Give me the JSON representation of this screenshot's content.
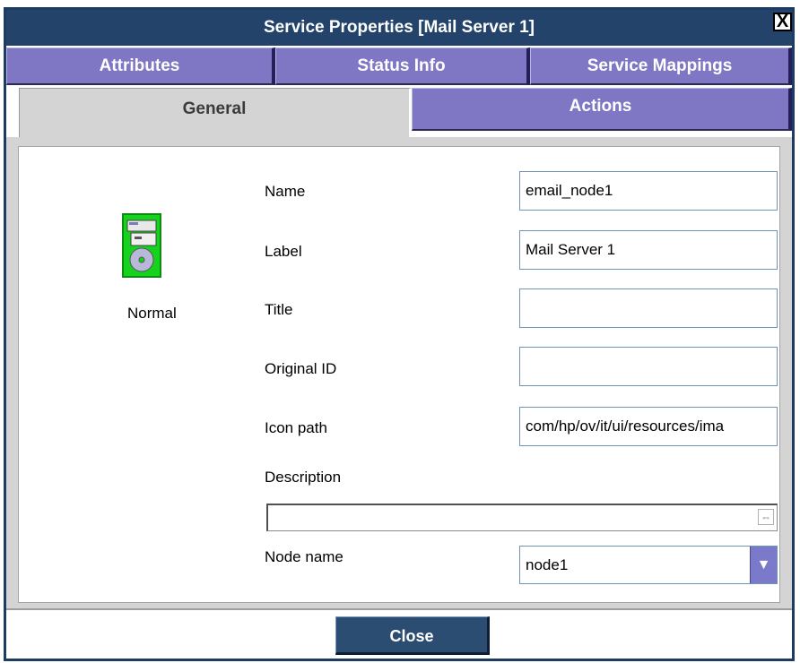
{
  "window": {
    "title": "Service Properties [Mail Server 1]",
    "close_glyph": "X"
  },
  "tabs_row1": [
    {
      "label": "Attributes"
    },
    {
      "label": "Status Info"
    },
    {
      "label": "Service Mappings"
    }
  ],
  "tabs_row2": [
    {
      "label": "General",
      "active": true
    },
    {
      "label": "Actions",
      "active": false
    }
  ],
  "status": {
    "label": "Normal",
    "icon": "server-computer-icon",
    "color": "#17d11f"
  },
  "form": {
    "name": {
      "label": "Name",
      "value": "email_node1"
    },
    "label": {
      "label": "Label",
      "value": "Mail Server 1"
    },
    "title": {
      "label": "Title",
      "value": ""
    },
    "original_id": {
      "label": "Original ID",
      "value": ""
    },
    "icon_path": {
      "label": "Icon path",
      "value": "com/hp/ov/it/ui/resources/ima"
    },
    "description": {
      "label": "Description",
      "value": ""
    },
    "node_name": {
      "label": "Node name",
      "value": "node1"
    }
  },
  "footer": {
    "close_label": "Close"
  },
  "colors": {
    "titlebar": "#23436b",
    "tab": "#7f77c3",
    "button": "#2c4d72"
  }
}
